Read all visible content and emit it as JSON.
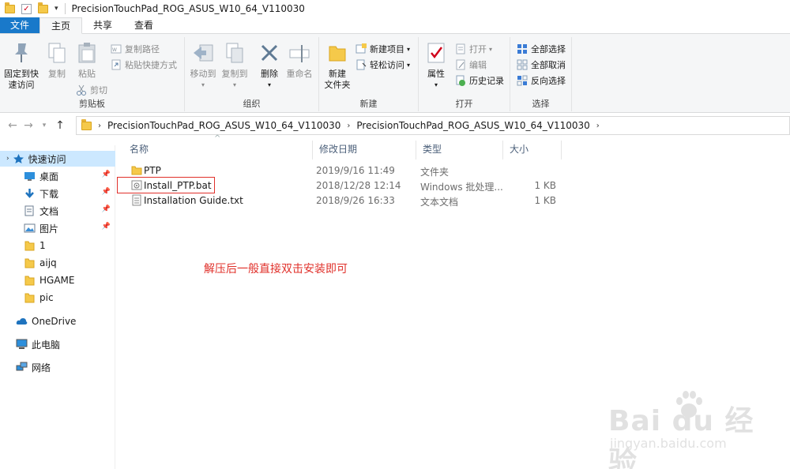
{
  "window": {
    "title": "PrecisionTouchPad_ROG_ASUS_W10_64_V110030"
  },
  "ribbon_tabs": [
    "文件",
    "主页",
    "共享",
    "查看"
  ],
  "ribbon": {
    "clipboard": {
      "pin_quick": "固定到快\n速访问",
      "copy": "复制",
      "paste": "粘贴",
      "copy_path": "复制路径",
      "paste_shortcut": "粘贴快捷方式",
      "cut": "剪切",
      "label": "剪贴板"
    },
    "organize": {
      "move_to": "移动到",
      "copy_to": "复制到",
      "delete": "删除",
      "rename": "重命名",
      "label": "组织"
    },
    "new": {
      "new_folder": "新建\n文件夹",
      "new_item": "新建项目",
      "easy_access": "轻松访问",
      "label": "新建"
    },
    "open": {
      "properties": "属性",
      "open": "打开",
      "edit": "编辑",
      "history": "历史记录",
      "label": "打开"
    },
    "select": {
      "select_all": "全部选择",
      "select_none": "全部取消",
      "invert": "反向选择",
      "label": "选择"
    }
  },
  "address": {
    "crumbs": [
      "PrecisionTouchPad_ROG_ASUS_W10_64_V110030",
      "PrecisionTouchPad_ROG_ASUS_W10_64_V110030"
    ]
  },
  "nav": {
    "quick_access": "快速访问",
    "items": [
      {
        "label": "桌面",
        "icon": "desktop-icon",
        "pinned": true
      },
      {
        "label": "下载",
        "icon": "download-icon",
        "pinned": true
      },
      {
        "label": "文档",
        "icon": "documents-icon",
        "pinned": true
      },
      {
        "label": "图片",
        "icon": "pictures-icon",
        "pinned": true
      },
      {
        "label": "1",
        "icon": "folder-icon",
        "pinned": false
      },
      {
        "label": "aijq",
        "icon": "folder-icon",
        "pinned": false
      },
      {
        "label": "HGAME",
        "icon": "folder-icon",
        "pinned": false
      },
      {
        "label": "pic",
        "icon": "folder-icon",
        "pinned": false
      }
    ],
    "onedrive": "OneDrive",
    "this_pc": "此电脑",
    "network": "网络"
  },
  "columns": [
    "名称",
    "修改日期",
    "类型",
    "大小"
  ],
  "files": [
    {
      "name": "PTP",
      "date": "2019/9/16 11:49",
      "type": "文件夹",
      "size": "",
      "icon": "folder-icon"
    },
    {
      "name": "Install_PTP.bat",
      "date": "2018/12/28 12:14",
      "type": "Windows 批处理...",
      "size": "1 KB",
      "icon": "bat-file-icon"
    },
    {
      "name": "Installation Guide.txt",
      "date": "2018/9/26 16:33",
      "type": "文本文档",
      "size": "1 KB",
      "icon": "text-file-icon"
    }
  ],
  "annotation": "解压后一般直接双击安装即可",
  "watermark": {
    "main": "Bai du 经验",
    "sub": "jingyan.baidu.com"
  },
  "colors": {
    "file_tab": "#1979ca",
    "selected_nav": "#cce8ff",
    "annotation": "#e0302a",
    "folder": "#f5c94a"
  }
}
